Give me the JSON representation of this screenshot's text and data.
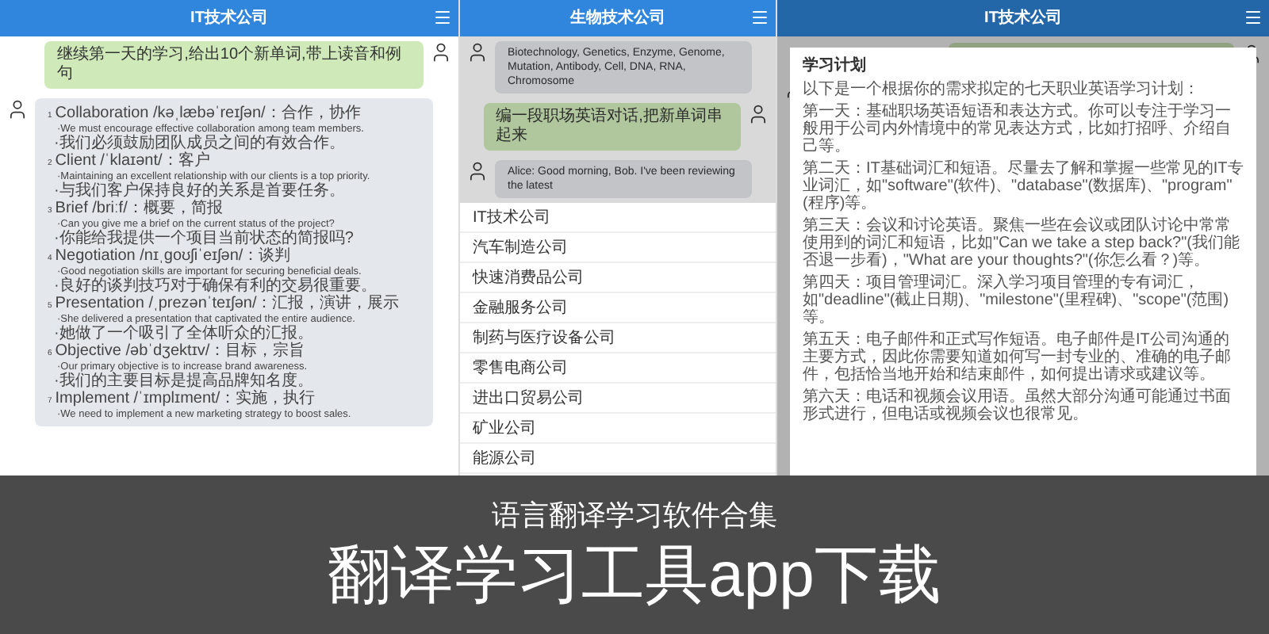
{
  "panels": [
    {
      "kind": "chat",
      "header": {
        "title": "IT技术公司"
      },
      "messages": [
        {
          "kind": "user",
          "text": "继续第一天的学习,给出10个新单词,带上读音和例句"
        },
        {
          "kind": "vocab",
          "items": [
            {
              "number": "1",
              "word": "Collaboration /kəˌlæbəˈreɪʃən/：合作，协作",
              "example_en": "·We must encourage effective collaboration among team members.",
              "example_zh": "·我们必须鼓励团队成员之间的有效合作。"
            },
            {
              "number": "2",
              "word": "Client /ˈklaɪənt/：客户",
              "example_en": "·Maintaining an excellent relationship with our clients is a top priority.",
              "example_zh": "·与我们客户保持良好的关系是首要任务。"
            },
            {
              "number": "3",
              "word": "Brief /briːf/：概要，简报",
              "example_en": "·Can you give me a brief on the current status of the project?",
              "example_zh": "·你能给我提供一个项目当前状态的简报吗?"
            },
            {
              "number": "4",
              "word": "Negotiation /nɪˌɡoʊʃiˈeɪʃən/：谈判",
              "example_en": "·Good negotiation skills are important for securing beneficial deals.",
              "example_zh": "·良好的谈判技巧对于确保有利的交易很重要。"
            },
            {
              "number": "5",
              "word": "Presentation /ˌprezənˈteɪʃən/：汇报，演讲，展示",
              "example_en": "·She delivered a presentation that captivated the entire audience.",
              "example_zh": "·她做了一个吸引了全体听众的汇报。"
            },
            {
              "number": "6",
              "word": "Objective /əbˈdʒektɪv/：目标，宗旨",
              "example_en": "·Our primary objective is to increase brand awareness.",
              "example_zh": "·我们的主要目标是提高品牌知名度。"
            },
            {
              "number": "7",
              "word": "Implement /ˈɪmplɪment/：实施，执行",
              "example_en": "·We need to implement a new marketing strategy to boost sales."
            }
          ]
        }
      ]
    },
    {
      "kind": "menu",
      "header": {
        "title": "生物技术公司"
      },
      "messages": [
        {
          "kind": "bot",
          "text": "Biotechnology, Genetics, Enzyme, Genome, Mutation, Antibody, Cell, DNA, RNA, Chromosome"
        },
        {
          "kind": "user",
          "text": "编一段职场英语对话,把新单词串起来"
        },
        {
          "kind": "bot",
          "text": "Alice: Good morning, Bob. I've been reviewing the latest"
        }
      ],
      "menu": {
        "items": [
          {
            "label": "IT技术公司"
          },
          {
            "label": "汽车制造公司"
          },
          {
            "label": "快速消费品公司"
          },
          {
            "label": "金融服务公司"
          },
          {
            "label": "制药与医疗设备公司"
          },
          {
            "label": "零售电商公司"
          },
          {
            "label": "进出口贸易公司"
          },
          {
            "label": "矿业公司"
          },
          {
            "label": "能源公司"
          }
        ]
      }
    },
    {
      "kind": "dialog",
      "header": {
        "title": "IT技术公司"
      },
      "dialog": {
        "title": "学习计划",
        "paragraphs": [
          "以下是一个根据你的需求拟定的七天职业英语学习计划：",
          "第一天：基础职场英语短语和表达方式。你可以专注于学习一般用于公司内外情境中的常见表达方式，比如打招呼、介绍自己等。",
          "第二天：IT基础词汇和短语。尽量去了解和掌握一些常见的IT专业词汇，如\"software\"(软件)、\"database\"(数据库)、\"program\"(程序)等。",
          "第三天：会议和讨论英语。聚焦一些在会议或团队讨论中常常使用到的词汇和短语，比如\"Can we take a step back?\"(我们能否退一步看)，\"What are your thoughts?\"(你怎么看？)等。",
          "第四天：项目管理词汇。深入学习项目管理的专有词汇，如\"deadline\"(截止日期)、\"milestone\"(里程碑)、\"scope\"(范围)等。",
          "第五天：电子邮件和正式写作短语。电子邮件是IT公司沟通的主要方式，因此你需要知道如何写一封专业的、准确的电子邮件，包括恰当地开始和结束邮件，如何提出请求或建议等。",
          "第六天：电话和视频会议用语。虽然大部分沟通可能通过书面形式进行，但电话或视频会议也很常见。"
        ]
      }
    }
  ],
  "banner": {
    "subtitle": "语言翻译学习软件合集",
    "title": "翻译学习工具app下载"
  }
}
